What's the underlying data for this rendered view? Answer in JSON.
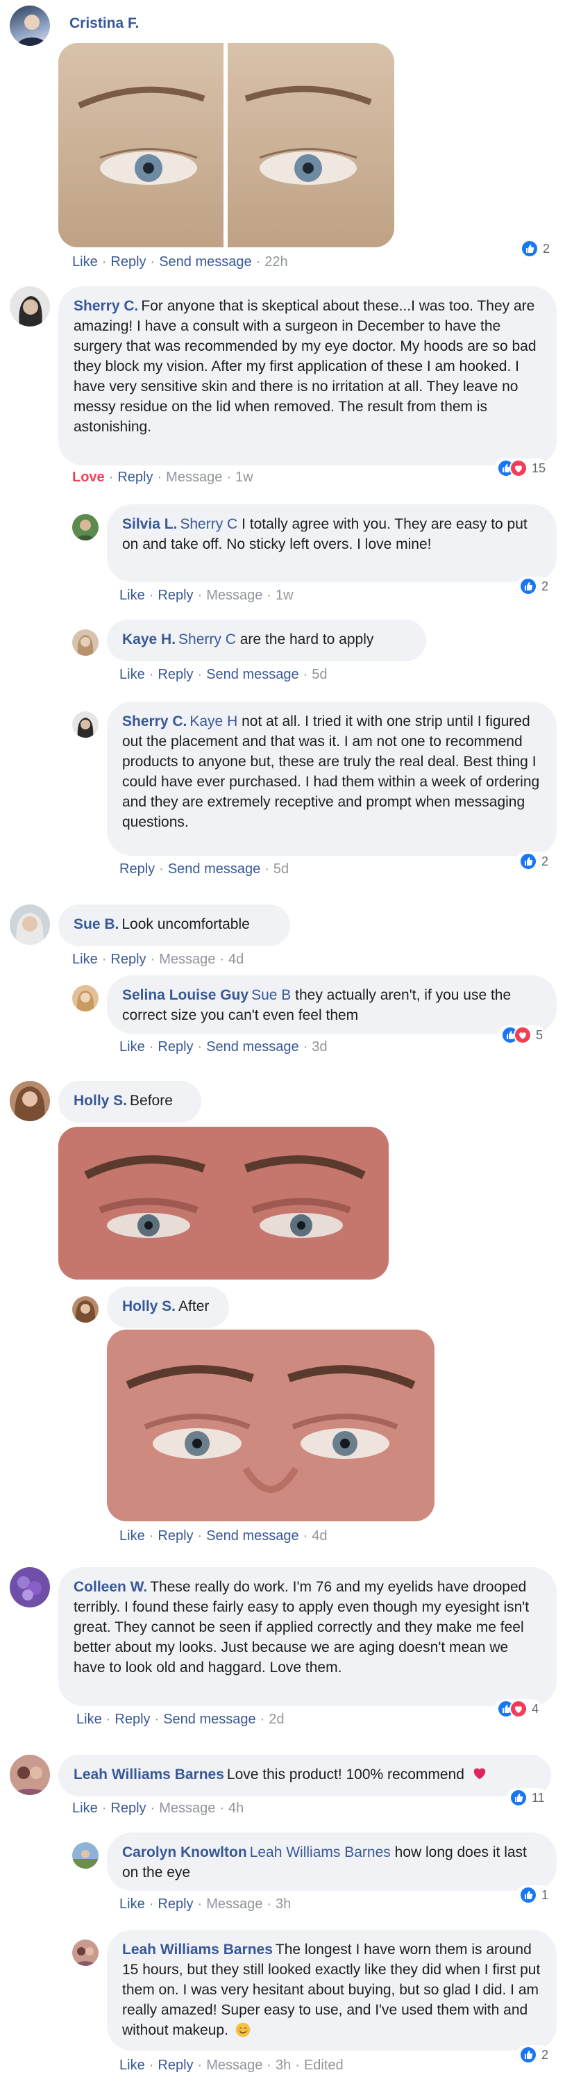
{
  "actions": {
    "like": "Like",
    "reply": "Reply",
    "send_message": "Send message",
    "message": "Message",
    "love": "Love",
    "edited": "Edited"
  },
  "comments": [
    {
      "author": "Cristina F.",
      "text": "",
      "time": "22h",
      "reactions": "2"
    },
    {
      "author": "Sherry C.",
      "text": "For anyone that is skeptical about these...I was too. They are amazing! I have a consult with a surgeon in December to have the surgery that was recommended by my eye doctor. My hoods are so bad they block my vision. After my first application of these I am hooked. I have very sensitive skin and there is no irritation at all. They leave no messy residue on the lid when removed. The result from them is astonishing.",
      "time": "1w",
      "reactions": "15"
    },
    {
      "author": "Silvia L.",
      "mention": "Sherry C",
      "text": "I totally agree with you. They are easy to put on and take off. No sticky left overs. I love mine!",
      "time": "1w",
      "reactions": "2"
    },
    {
      "author": "Kaye H.",
      "mention": "Sherry C",
      "text": "are the hard to apply",
      "time": "5d"
    },
    {
      "author": "Sherry C.",
      "mention": "Kaye H",
      "text": "not at all. I tried it with one strip until I figured out the placement and that was it. I am not one to recommend products to anyone but, these are truly the real deal. Best thing I could have ever purchased. I had them within a week of ordering and they are extremely receptive and prompt when messaging questions.",
      "time": "5d",
      "reactions": "2"
    },
    {
      "author": "Sue B.",
      "text": "Look uncomfortable",
      "time": "4d"
    },
    {
      "author": "Selina Louise Guy",
      "mention": "Sue B",
      "text": "they actually aren't, if you use the correct size you can't even feel them",
      "time": "3d",
      "reactions": "5"
    },
    {
      "author": "Holly S.",
      "text": "Before"
    },
    {
      "author": "Holly S.",
      "text": "After",
      "time": "4d"
    },
    {
      "author": "Colleen W.",
      "text": "These really do work. I'm 76 and my eyelids have drooped terribly. I found these fairly easy to apply even though my eyesight isn't great. They cannot be seen if applied correctly and they make me feel better about my looks. Just because we are aging doesn't mean we have to look old and haggard. Love them.",
      "time": "2d",
      "reactions": "4"
    },
    {
      "author": "Leah Williams Barnes",
      "text": "Love this product! 100% recommend",
      "time": "4h",
      "reactions": "11"
    },
    {
      "author": "Carolyn Knowlton",
      "mention": "Leah Williams Barnes",
      "text": "how long does it last on the eye",
      "time": "3h",
      "reactions": "1"
    },
    {
      "author": "Leah Williams Barnes",
      "text": "The longest I have worn them is around 15 hours, but they still looked exactly like they did when I first put them on. I was very hesitant about buying, but so glad I did. I am really amazed! Super easy to use, and I've used them with and without makeup.",
      "time": "3h",
      "reactions": "2"
    }
  ],
  "colors": {
    "link": "#385898",
    "bubble": "#f0f2f5",
    "like": "#1877f2",
    "love": "#f33e58"
  }
}
